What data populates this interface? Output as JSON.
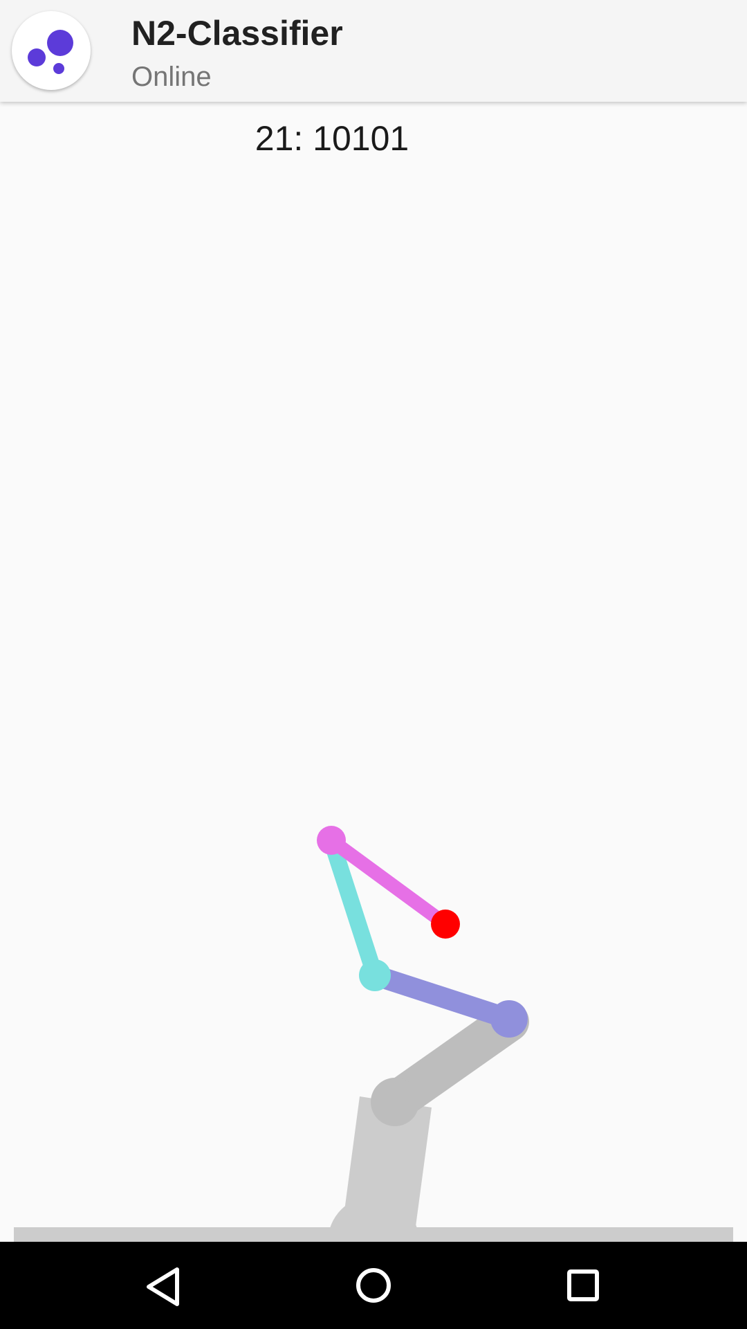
{
  "header": {
    "title": "N2-Classifier",
    "status": "Online",
    "avatar_icon": "bubbles-logo-icon",
    "avatar_color": "#5c3bd9"
  },
  "game": {
    "score_text": "21: 10101"
  },
  "arm_colors": {
    "base": "#cccccc",
    "upper_link": "#bdbdbd",
    "link_1": "#9090dc",
    "link_2": "#78e0de",
    "link_3": "#e670e6",
    "target": "#ff0000",
    "ground": "#cccccc"
  },
  "nav": {
    "back_icon": "back-triangle-icon",
    "home_icon": "home-circle-icon",
    "recents_icon": "recents-square-icon"
  }
}
